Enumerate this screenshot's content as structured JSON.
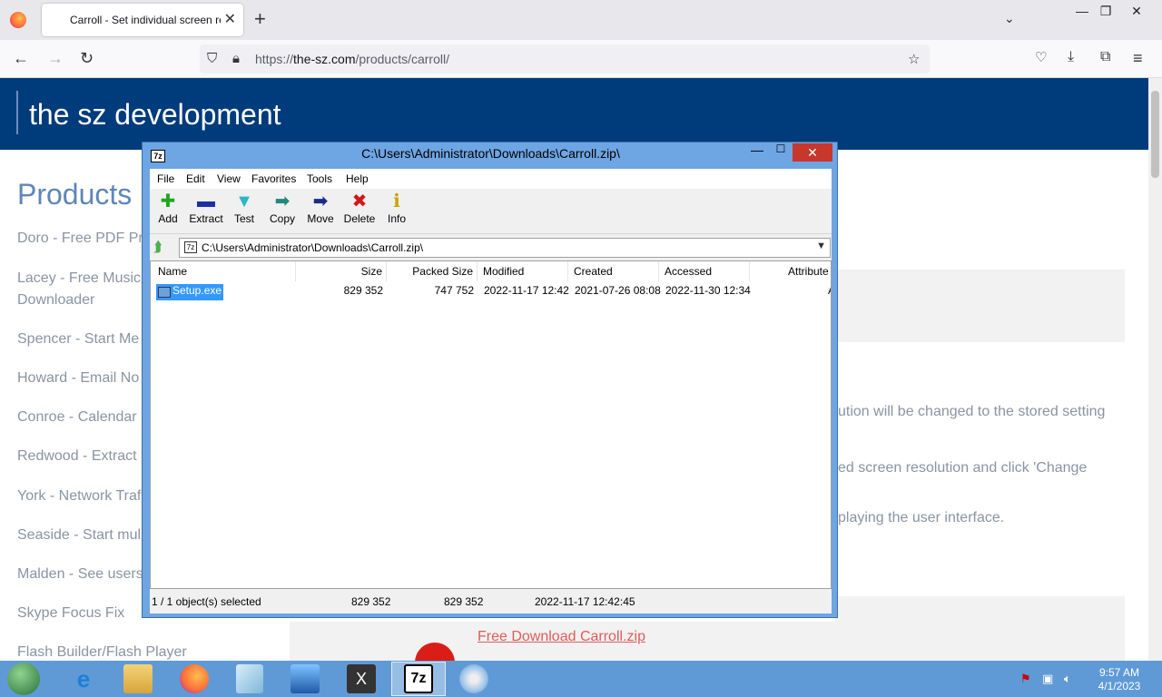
{
  "browser": {
    "tab_title": "Carroll - Set individual screen re",
    "tab_close": "✕",
    "new_tab": "+",
    "url_prefix": "https://",
    "url_host": "the-sz.com",
    "url_path": "/products/carroll/"
  },
  "site": {
    "brand": "the sz development",
    "products_heading": "Products",
    "products": [
      "Doro - Free PDF Pr",
      "Lacey - Free Music",
      "Downloader",
      "Spencer - Start Me",
      "Howard - Email No",
      "Conroe - Calendar",
      "Redwood - Extract",
      "York - Network Traf",
      "Seaside - Start mul",
      "Malden - See users",
      "Skype Focus Fix",
      "Flash Builder/Flash Player"
    ],
    "body_lines": [
      "ution will be changed to the stored setting",
      "ed screen resolution and click 'Change",
      "playing the user interface."
    ],
    "download_link": "Free Download Carroll.zip"
  },
  "zip": {
    "title": "C:\\Users\\Administrator\\Downloads\\Carroll.zip\\",
    "app_icon": "7z",
    "menu": [
      "File",
      "Edit",
      "View",
      "Favorites",
      "Tools",
      "Help"
    ],
    "tools": [
      {
        "label": "Add",
        "icon": "plus-icon",
        "glyph": "✚",
        "color": "#1fa81f"
      },
      {
        "label": "Extract",
        "icon": "minus-icon",
        "glyph": "▬",
        "color": "#1c2fa8"
      },
      {
        "label": "Test",
        "icon": "check-icon",
        "glyph": "▼",
        "color": "#2bb5c9"
      },
      {
        "label": "Copy",
        "icon": "arrow-right-icon",
        "glyph": "➡",
        "color": "#1f8a7a"
      },
      {
        "label": "Move",
        "icon": "arrow-move-icon",
        "glyph": "➡",
        "color": "#1c2a8a"
      },
      {
        "label": "Delete",
        "icon": "x-icon",
        "glyph": "✖",
        "color": "#d01818"
      },
      {
        "label": "Info",
        "icon": "info-icon",
        "glyph": "ℹ",
        "color": "#c9a200"
      }
    ],
    "address": "C:\\Users\\Administrator\\Downloads\\Carroll.zip\\",
    "columns": [
      "Name",
      "Size",
      "Packed Size",
      "Modified",
      "Created",
      "Accessed",
      "Attribute"
    ],
    "rows": [
      {
        "name": "Setup.exe",
        "size": "829 352",
        "packed": "747 752",
        "modified": "2022-11-17 12:42",
        "created": "2021-07-26 08:08",
        "accessed": "2022-11-30 12:34",
        "attr": "A"
      }
    ],
    "status": {
      "selected": "1 / 1 object(s) selected",
      "size": "829 352",
      "packed": "829 352",
      "modified": "2022-11-17 12:42:45"
    }
  },
  "taskbar": {
    "time": "9:57 AM",
    "date": "4/1/2023"
  }
}
